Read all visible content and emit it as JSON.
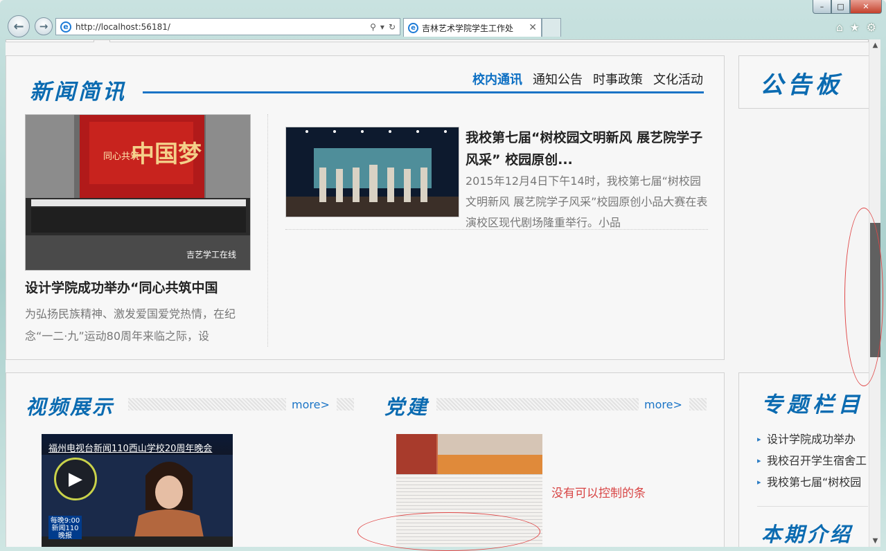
{
  "browser": {
    "url": "http://localhost:56181/",
    "tab_title": "吉林艺术学院学生工作处",
    "window_controls": {
      "minimize": "–",
      "maximize": "□",
      "close": "✕"
    }
  },
  "news": {
    "heading": "新闻简讯",
    "tabs": [
      "校内通讯",
      "通知公告",
      "时事政策",
      "文化活动"
    ],
    "lead_image_text": {
      "line1": "同心共筑",
      "line2": "中国梦",
      "watermark": "吉艺学工在线"
    },
    "lead_title": "设计学院成功举办“同心共筑中国",
    "lead_desc": "为弘扬民族精神、激发爱国爱党热情，在纪念“一二·九”运动80周年来临之际，设",
    "item_title": "我校第七届“树校园文明新风 展艺院学子风采” 校园原创...",
    "item_desc": "2015年12月4日下午14时，我校第七届“树校园文明新风 展艺院学子风采”校园原创小品大赛在表演校区现代剧场隆重举行。小品"
  },
  "notice": {
    "heading": "公告板"
  },
  "video": {
    "heading": "视频展示",
    "more": "more>",
    "caption": "福州电视台新闻110西山学校20周年晚会",
    "badge_line1": "每晚9:00",
    "badge_line2": "新闻110",
    "badge_line3": "晚报"
  },
  "party": {
    "heading": "党建",
    "more": "more>"
  },
  "topics": {
    "heading": "专题栏目",
    "items": [
      "设计学院成功举办",
      "我校召开学生宿舍工",
      "我校第七届“树校园"
    ],
    "heading2": "本期介绍"
  },
  "annotation": "没有可以控制的条",
  "colors": {
    "brand_blue": "#0b6bb1",
    "annotation_red": "#d84545"
  }
}
